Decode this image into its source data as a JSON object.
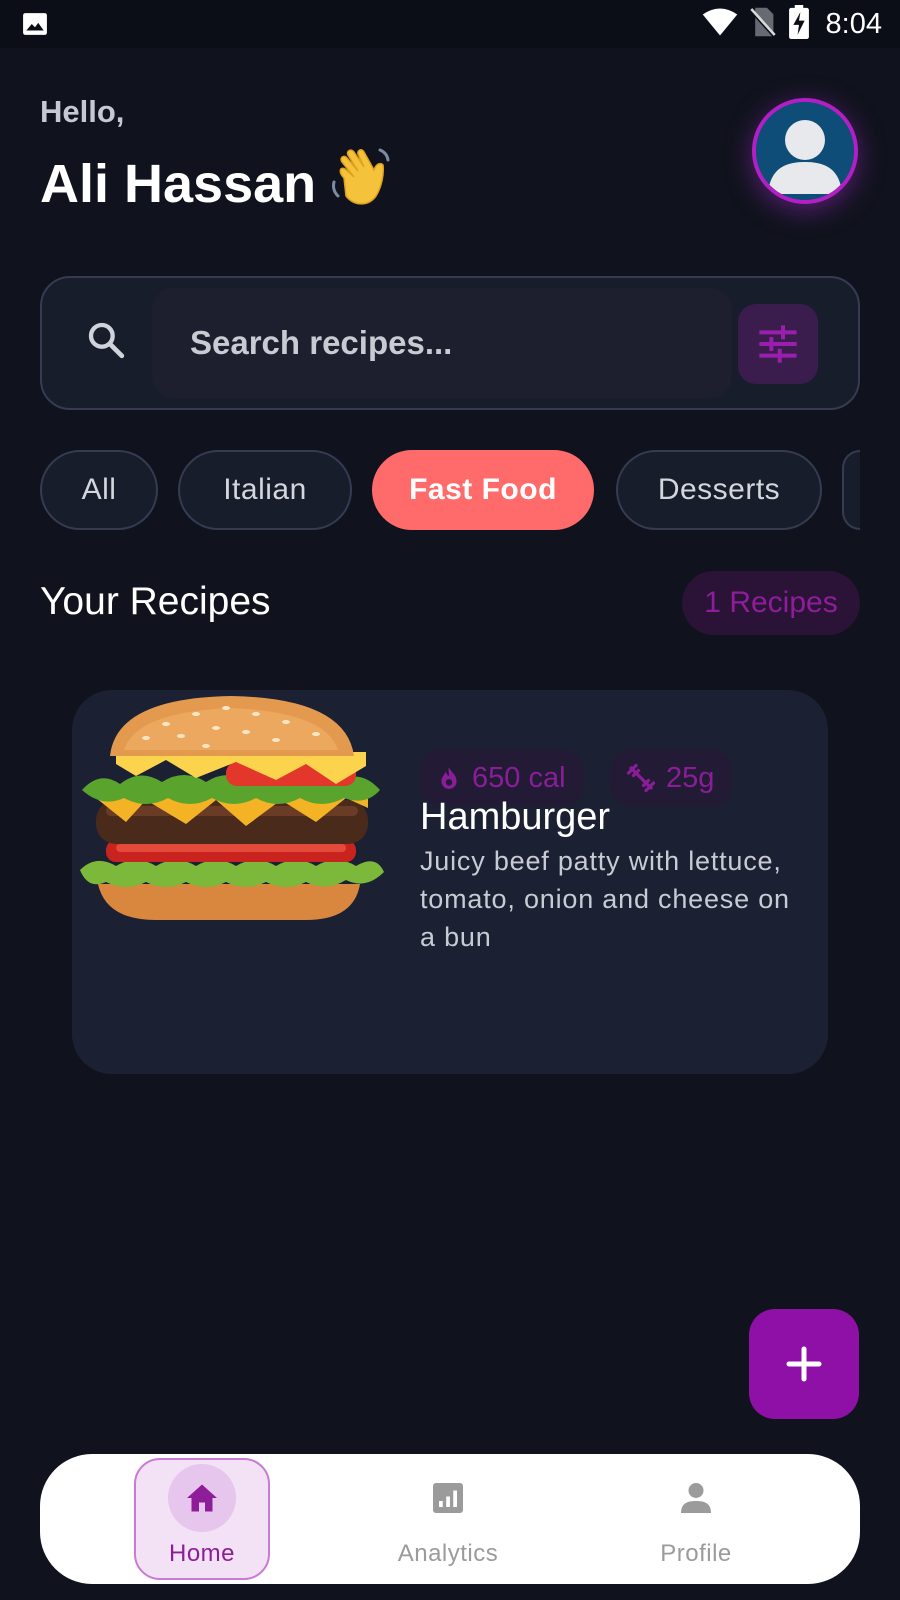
{
  "status_bar": {
    "time": "8:04",
    "icons": [
      "image-icon",
      "wifi-icon",
      "no-sim-icon",
      "battery-charging-icon"
    ]
  },
  "header": {
    "greeting": "Hello,",
    "user_name": "Ali Hassan",
    "emoji": "waving-hand-icon",
    "avatar": "person-avatar-icon"
  },
  "search": {
    "placeholder": "Search recipes...",
    "value": "",
    "filter_icon": "tune-icon"
  },
  "categories": [
    {
      "label": "All",
      "active": false
    },
    {
      "label": "Italian",
      "active": false
    },
    {
      "label": "Fast Food",
      "active": true
    },
    {
      "label": "Desserts",
      "active": false
    }
  ],
  "recipes_section": {
    "title": "Your Recipes",
    "count_label": "1 Recipes"
  },
  "recipes": [
    {
      "title": "Hamburger",
      "description": "Juicy beef patty with lettuce, tomato, onion and cheese on a bun",
      "calories": "650 cal",
      "protein": "25g",
      "image": "hamburger-image"
    }
  ],
  "fab": {
    "icon": "plus-icon"
  },
  "bottom_nav": [
    {
      "label": "Home",
      "icon": "home-icon",
      "active": true
    },
    {
      "label": "Analytics",
      "icon": "analytics-icon",
      "active": false
    },
    {
      "label": "Profile",
      "icon": "person-icon",
      "active": false
    }
  ],
  "colors": {
    "background": "#10131d",
    "card": "#1b2033",
    "accent_purple": "#8e10a6",
    "active_chip": "#ff6b6b",
    "nav_bg": "#ffffff"
  }
}
